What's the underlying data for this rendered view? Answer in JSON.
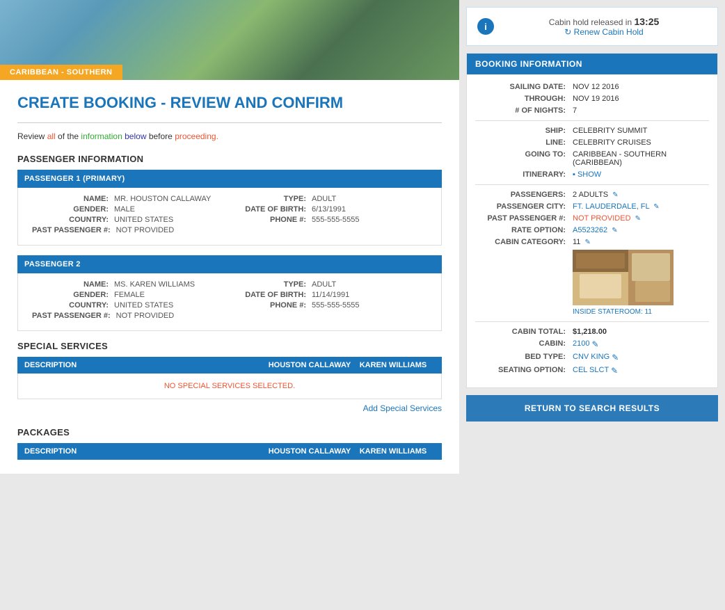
{
  "region": "CARIBBEAN - SOUTHERN",
  "pageTitle": {
    "prefix": "CREATE BOOKING - ",
    "highlight": "REVIEW AND CONFIRM"
  },
  "reviewNotice": "Review all of the information below before proceeding.",
  "passengerSection": "PASSENGER INFORMATION",
  "passengers": [
    {
      "header": "PASSENGER 1 (PRIMARY)",
      "nameLabel": "NAME:",
      "nameValue": "MR. HOUSTON CALLAWAY",
      "typeLabel": "TYPE:",
      "typeValue": "ADULT",
      "dobLabel": "DATE OF BIRTH:",
      "dobValue": "6/13/1991",
      "genderLabel": "GENDER:",
      "genderValue": "MALE",
      "phoneLabel": "PHONE #:",
      "phoneValue": "555-555-5555",
      "countryLabel": "COUNTRY:",
      "countryValue": "UNITED STATES",
      "pastPassLabel": "PAST PASSENGER #:",
      "pastPassValue": "NOT PROVIDED"
    },
    {
      "header": "PASSENGER 2",
      "nameLabel": "NAME:",
      "nameValue": "MS. KAREN WILLIAMS",
      "typeLabel": "TYPE:",
      "typeValue": "ADULT",
      "dobLabel": "DATE OF BIRTH:",
      "dobValue": "11/14/1991",
      "genderLabel": "GENDER:",
      "genderValue": "FEMALE",
      "phoneLabel": "PHONE #:",
      "phoneValue": "555-555-5555",
      "countryLabel": "COUNTRY:",
      "countryValue": "UNITED STATES",
      "pastPassLabel": "PAST PASSENGER #:",
      "pastPassValue": "NOT PROVIDED"
    }
  ],
  "specialServices": {
    "sectionTitle": "SPECIAL SERVICES",
    "col1": "DESCRIPTION",
    "col2": "HOUSTON CALLAWAY",
    "col3": "KAREN WILLIAMS",
    "noServices": "NO SPECIAL SERVICES SELECTED.",
    "addLink": "Add Special Services"
  },
  "packages": {
    "sectionTitle": "PACKAGES",
    "col1": "DESCRIPTION",
    "col2": "HOUSTON CALLAWAY",
    "col3": "KAREN WILLIAMS"
  },
  "sidebar": {
    "cabinHold": {
      "text": "Cabin hold released in",
      "timer": "13:25",
      "renewLabel": "↻ Renew Cabin Hold"
    },
    "bookingInfo": {
      "header": "BOOKING INFORMATION",
      "rows": [
        {
          "label": "SAILING DATE:",
          "value": "NOV 12 2016"
        },
        {
          "label": "THROUGH:",
          "value": "NOV 19 2016"
        },
        {
          "label": "# OF NIGHTS:",
          "value": "7"
        },
        {
          "label": "SHIP:",
          "value": "CELEBRITY SUMMIT"
        },
        {
          "label": "LINE:",
          "value": "CELEBRITY CRUISES"
        },
        {
          "label": "GOING TO:",
          "value": "CARIBBEAN - SOUTHERN (CARIBBEAN)"
        },
        {
          "label": "ITINERARY:",
          "value": "SHOW",
          "link": true
        },
        {
          "label": "PASSENGERS:",
          "value": "2 ADULTS",
          "edit": true
        },
        {
          "label": "PASSENGER CITY:",
          "value": "FT. LAUDERDALE, FL",
          "edit": true
        },
        {
          "label": "PAST PASSENGER #:",
          "value": "NOT PROVIDED",
          "edit": true
        },
        {
          "label": "RATE OPTION:",
          "value": "A5523262",
          "edit": true
        },
        {
          "label": "CABIN CATEGORY:",
          "value": "11",
          "edit": true
        }
      ],
      "cabinImageLabel": "INSIDE STATEROOM: 11",
      "cabinTotalLabel": "CABIN TOTAL:",
      "cabinTotalValue": "$1,218.00",
      "cabinLabel": "CABIN:",
      "cabinValue": "2100",
      "bedTypeLabel": "BED TYPE:",
      "bedTypeValue": "CNV KING",
      "seatingLabel": "SEATING OPTION:",
      "seatingValue": "CEL SLCT"
    }
  },
  "returnBtn": "RETURN TO SEARCH RESULTS"
}
